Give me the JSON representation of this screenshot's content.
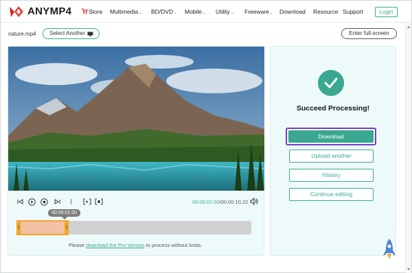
{
  "header": {
    "brand": "ANYMP4",
    "nav": [
      {
        "label": "Store",
        "dropdown": false,
        "icon": "cart-icon"
      },
      {
        "label": "Multimedia",
        "dropdown": true
      },
      {
        "label": "BD/DVD",
        "dropdown": true
      },
      {
        "label": "Mobile",
        "dropdown": true
      },
      {
        "label": "Utility",
        "dropdown": true
      },
      {
        "label": "Freeware",
        "dropdown": true
      },
      {
        "label": "Download",
        "dropdown": false
      },
      {
        "label": "Resource",
        "dropdown": false
      },
      {
        "label": "Support",
        "dropdown": false
      }
    ],
    "login_label": "Login"
  },
  "file_bar": {
    "filename": "nature.mp4",
    "select_another_label": "Select Another",
    "fullscreen_label": "Enter full-screen"
  },
  "player": {
    "current_time": "00:00:02.00",
    "total_time": "/00:00:10.22",
    "tooltip_time": "00:00:02.00",
    "selection_fraction": 0.2,
    "note_prefix": "Please ",
    "note_link": "download the Pro Version",
    "note_suffix": " to process without limits."
  },
  "result": {
    "status": "Succeed Processing!",
    "download_label": "Download",
    "upload_another_label": "Upload another",
    "history_label": "History",
    "continue_label": "Continue editing"
  },
  "colors": {
    "accent": "#3aa890",
    "highlight": "#7a38c7",
    "selection": "#f0a72a"
  }
}
